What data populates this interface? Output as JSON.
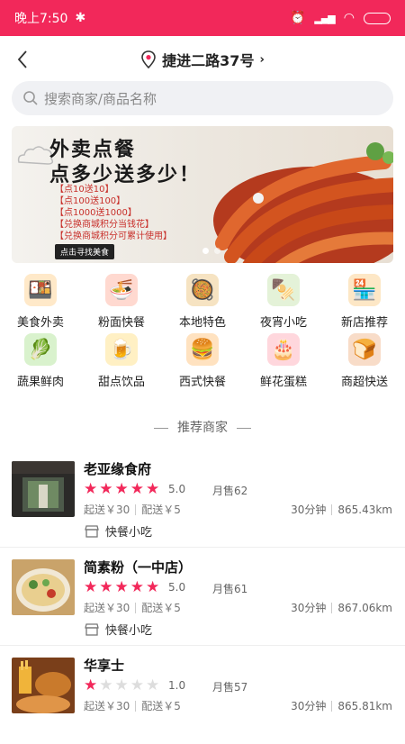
{
  "status": {
    "time": "晚上7:50"
  },
  "header": {
    "location": "捷进二路37号"
  },
  "search": {
    "placeholder": "搜索商家/商品名称"
  },
  "banner": {
    "headline1": "外卖点餐",
    "headline2": "点多少送多少！",
    "promos": [
      "【点10送10】",
      "【点100送100】",
      "【点1000送1000】",
      "【兑换商城积分当钱花】",
      "【兑换商城积分可累计使用】"
    ],
    "cta": "点击寻找美食"
  },
  "categories": [
    {
      "label": "美食外卖",
      "icon": "takeout-icon",
      "color": "#ffe9c9"
    },
    {
      "label": "粉面快餐",
      "icon": "noodle-bowl-icon",
      "color": "#ffd9d0"
    },
    {
      "label": "本地特色",
      "icon": "local-dish-icon",
      "color": "#f6e3c2"
    },
    {
      "label": "夜宵小吃",
      "icon": "skewer-icon",
      "color": "#e4f2d8"
    },
    {
      "label": "新店推荐",
      "icon": "store-icon",
      "color": "#fde7c6"
    },
    {
      "label": "蔬果鲜肉",
      "icon": "produce-icon",
      "color": "#d9f2cd"
    },
    {
      "label": "甜点饮品",
      "icon": "drink-icon",
      "color": "#fff0c4"
    },
    {
      "label": "西式快餐",
      "icon": "burger-icon",
      "color": "#ffe2c0"
    },
    {
      "label": "鲜花蛋糕",
      "icon": "cake-icon",
      "color": "#ffd7dd"
    },
    {
      "label": "商超快送",
      "icon": "bread-icon",
      "color": "#f8dcc8"
    }
  ],
  "section_title": "推荐商家",
  "shops": [
    {
      "name": "老亚缘食府",
      "stars": 5,
      "rating": "5.0",
      "sales": "月售62",
      "min_order": "起送￥30",
      "delivery": "配送￥5",
      "time": "30分钟",
      "distance": "865.43km",
      "tag": "快餐小吃"
    },
    {
      "name": "简素粉（一中店）",
      "stars": 5,
      "rating": "5.0",
      "sales": "月售61",
      "min_order": "起送￥30",
      "delivery": "配送￥5",
      "time": "30分钟",
      "distance": "867.06km",
      "tag": "快餐小吃"
    },
    {
      "name": "华享士",
      "stars": 1,
      "rating": "1.0",
      "sales": "月售57",
      "min_order": "起送￥30",
      "delivery": "配送￥5",
      "time": "30分钟",
      "distance": "865.81km",
      "tag": ""
    }
  ],
  "colors": {
    "brand": "#f2285a",
    "star_on": "#f2285a",
    "star_off": "#dddddd"
  }
}
